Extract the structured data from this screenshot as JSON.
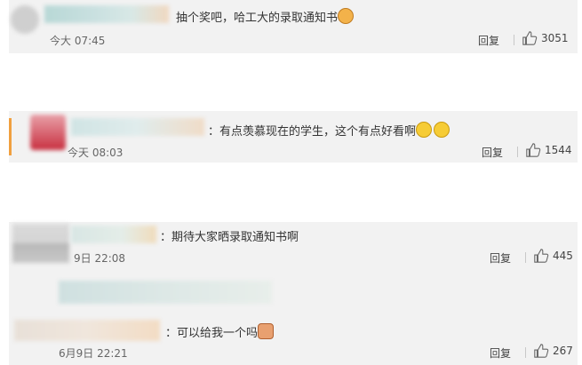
{
  "comments": [
    {
      "text": "抽个奖吧，哈工大的录取通知书",
      "time": "今大 07:45",
      "reply": "回复",
      "likes": "3051",
      "emoji": "cat-face"
    },
    {
      "text": "：有点羡慕现在的学生，这个有点好看啊",
      "time": "今天 08:03",
      "reply": "回复",
      "likes": "1544",
      "emoji": "crying-face"
    },
    {
      "text": "：期待大家晒录取通知书啊",
      "time": "9日 22:08",
      "reply": "回复",
      "likes": "445"
    },
    {
      "text": "：可以给我一个吗",
      "time": "6月9日 22:21",
      "reply": "回复",
      "likes": "267",
      "emoji": "pleading-sticker"
    }
  ]
}
